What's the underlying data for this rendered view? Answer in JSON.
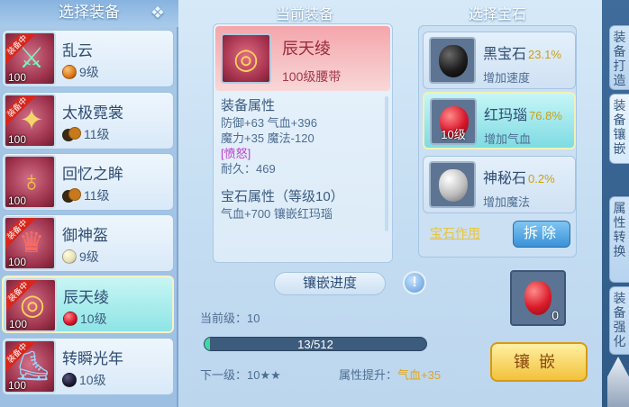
{
  "left_panel": {
    "title": "选择装备",
    "items": [
      {
        "name": "乱云",
        "level": "100",
        "gem_level": "9级",
        "equipped_badge": "装备中",
        "icon": "sword-icon",
        "gem_colors": [
          "#d97a1c"
        ],
        "selected": false
      },
      {
        "name": "太极霓裳",
        "level": "100",
        "gem_level": "11级",
        "equipped_badge": "装备中",
        "icon": "robe-icon",
        "gem_colors": [
          "#3a2a14",
          "#c8791b"
        ],
        "selected": false
      },
      {
        "name": "回忆之眸",
        "level": "100",
        "gem_level": "11级",
        "equipped_badge": "",
        "icon": "necklace-icon",
        "gem_colors": [
          "#3a2a14",
          "#c8791b"
        ],
        "selected": false
      },
      {
        "name": "御神盔",
        "level": "100",
        "gem_level": "9级",
        "equipped_badge": "装备中",
        "icon": "helmet-icon",
        "gem_colors": [
          "#e6e1b8"
        ],
        "selected": false
      },
      {
        "name": "辰天绫",
        "level": "100",
        "gem_level": "10级",
        "equipped_badge": "装备中",
        "icon": "belt-icon",
        "gem_colors": [
          "#d7142a"
        ],
        "selected": true
      },
      {
        "name": "转瞬光年",
        "level": "100",
        "gem_level": "10级",
        "equipped_badge": "装备中",
        "icon": "boots-icon",
        "gem_colors": [
          "#1d1b33"
        ],
        "selected": false
      }
    ]
  },
  "center_panel": {
    "title": "当前装备",
    "item_name": "辰天绫",
    "item_type": "100级腰带",
    "attr_heading": "装备属性",
    "attr_lines": [
      "防御+63 气血+396",
      "魔力+35 魔法-120",
      "[愤怒]",
      "耐久：469"
    ],
    "gem_attr_heading": "宝石属性（等级10）",
    "gem_attr_line": "气血+700 镶嵌红玛瑙"
  },
  "progress": {
    "title": "镶嵌进度",
    "help_label": "!",
    "current_level": "当前级：10",
    "bar_text": "13/512",
    "fill_fraction": 0.025,
    "next_level": "下一级：10★★",
    "attr_up_label": "属性提升：",
    "attr_up_value": "气血+35"
  },
  "gem_panel": {
    "title": "选择宝石",
    "gems": [
      {
        "name": "黑宝石",
        "rate": "23.1%",
        "desc": "增加速度",
        "level": "",
        "stone_color": "#1c1c1c",
        "selected": false
      },
      {
        "name": "红玛瑙",
        "rate": "76.8%",
        "desc": "增加气血",
        "level": "10级",
        "stone_color": "#d7142a",
        "selected": true
      },
      {
        "name": "神秘石",
        "rate": "0.2%",
        "desc": "增加魔法",
        "level": "",
        "stone_color": "#bdbdbd",
        "selected": false
      }
    ],
    "effect_link": "宝石作用",
    "detach_label": "拆除"
  },
  "slot": {
    "count": "0"
  },
  "inlay_button": "镶嵌",
  "side_tabs": [
    "装备打造",
    "装备镶嵌",
    "属性转换",
    "装备强化"
  ]
}
